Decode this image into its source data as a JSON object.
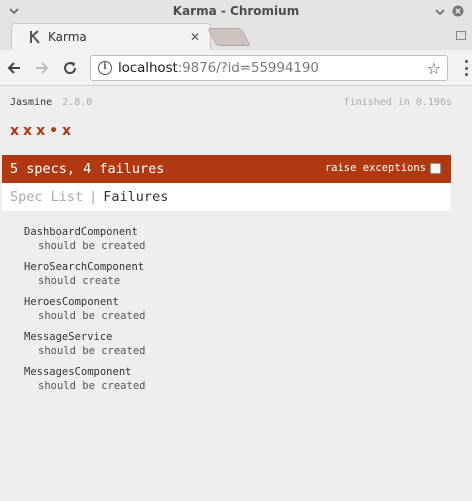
{
  "window": {
    "title": "Karma - Chromium"
  },
  "tabs": [
    {
      "title": "Karma",
      "favicon": "karma-icon"
    }
  ],
  "address_bar": {
    "host": "localhost",
    "rest": ":9876/?id=55994190"
  },
  "jasmine": {
    "name": "Jasmine",
    "version": "2.8.0",
    "duration": "finished in 0.196s",
    "symbols": [
      "x",
      "x",
      "x",
      "•",
      "x"
    ],
    "alert": "5 specs, 4 failures",
    "raise_exceptions": "raise exceptions",
    "menu": {
      "spec_list": "Spec List",
      "separator": "|",
      "failures": "Failures"
    },
    "suites": [
      {
        "name": "DashboardComponent",
        "spec": "should be created"
      },
      {
        "name": "HeroSearchComponent",
        "spec": "should create"
      },
      {
        "name": "HeroesComponent",
        "spec": "should be created"
      },
      {
        "name": "MessageService",
        "spec": "should be created"
      },
      {
        "name": "MessagesComponent",
        "spec": "should be created"
      }
    ]
  },
  "colors": {
    "failure": "#b03911",
    "page_bg": "#eeeeee"
  }
}
